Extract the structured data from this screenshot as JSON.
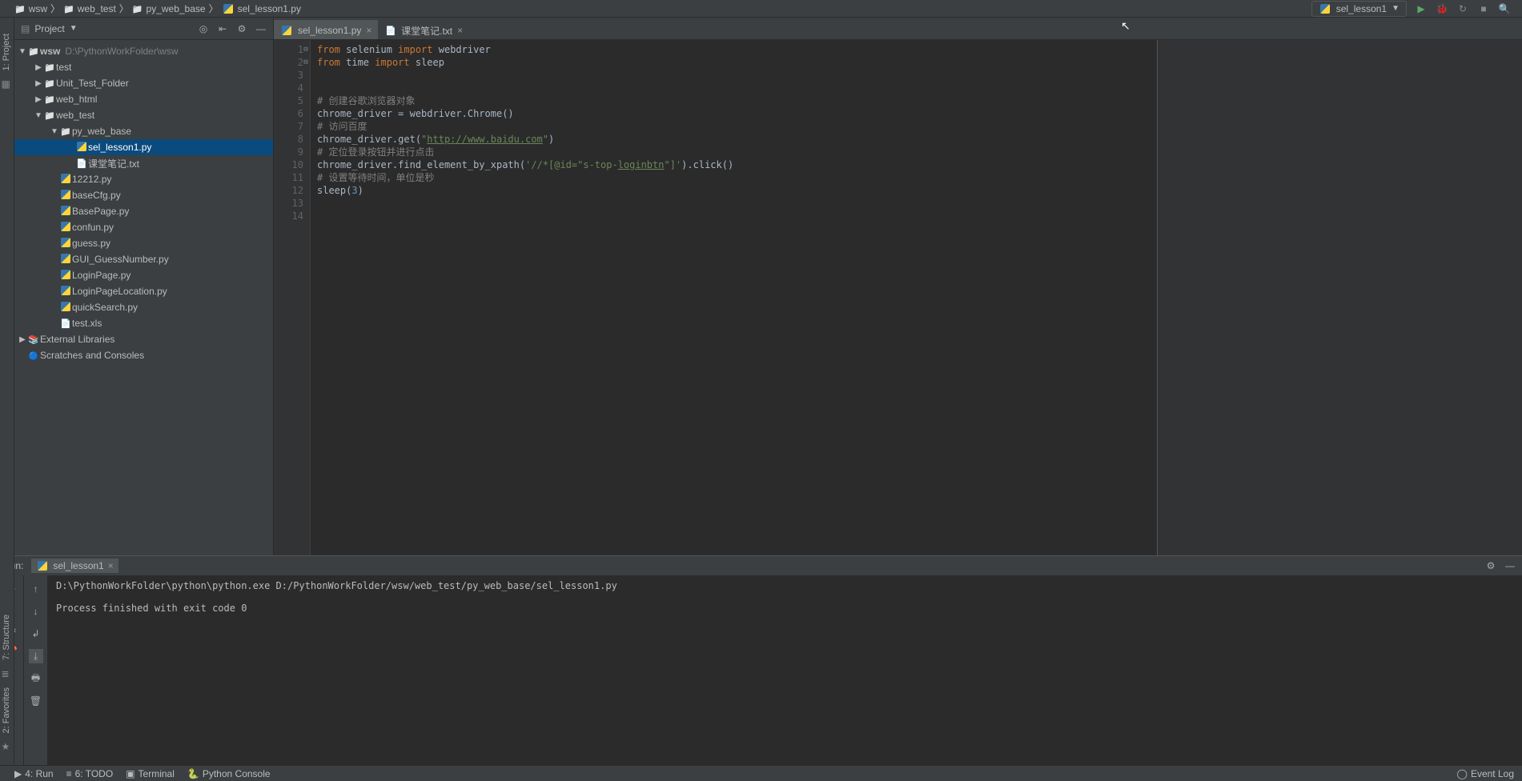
{
  "breadcrumb": {
    "root": "wsw",
    "p1": "web_test",
    "p2": "py_web_base",
    "file": "sel_lesson1.py"
  },
  "toolbar": {
    "run_config": "sel_lesson1"
  },
  "project": {
    "title": "Project",
    "root": "wsw",
    "root_path": "D:\\PythonWorkFolder\\wsw",
    "nodes": {
      "test": "test",
      "unit_test": "Unit_Test_Folder",
      "web_html": "web_html",
      "web_test": "web_test",
      "py_web_base": "py_web_base",
      "sel_lesson1": "sel_lesson1.py",
      "notes": "课堂笔记.txt",
      "f12212": "12212.py",
      "basecfg": "baseCfg.py",
      "basepage": "BasePage.py",
      "confun": "confun.py",
      "guess": "guess.py",
      "gui_guess": "GUI_GuessNumber.py",
      "loginpage": "LoginPage.py",
      "loginloc": "LoginPageLocation.py",
      "quicksearch": "quickSearch.py",
      "testxls": "test.xls",
      "extlib": "External Libraries",
      "scratch": "Scratches and Consoles"
    }
  },
  "tabs": {
    "t1": "sel_lesson1.py",
    "t2": "课堂笔记.txt"
  },
  "code": {
    "l1a": "from",
    "l1b": " selenium ",
    "l1c": "import",
    "l1d": " webdriver",
    "l2a": "from",
    "l2b": " time ",
    "l2c": "import",
    "l2d": " sleep",
    "l5": "# 创建谷歌浏览器对象",
    "l6a": "chrome_driver = webdriver.Chrome()",
    "l7": "# 访问百度",
    "l8a": "chrome_driver.get(",
    "l8b": "\"",
    "l8c": "http://www.baidu.com",
    "l8d": "\"",
    "l8e": ")",
    "l9": "# 定位登录按钮并进行点击",
    "l10a": "chrome_driver.find_element_by_xpath(",
    "l10b": "'//*[@id=\"s-top-",
    "l10c": "loginbtn",
    "l10d": "\"]'",
    "l10e": ").click()",
    "l11": "# 设置等待时间，单位是秒",
    "l12a": "sleep(",
    "l12b": "3",
    "l12c": ")"
  },
  "gutter": [
    "1",
    "2",
    "3",
    "4",
    "5",
    "6",
    "7",
    "8",
    "9",
    "10",
    "11",
    "12",
    "13",
    "14"
  ],
  "run": {
    "label": "Run:",
    "tab": "sel_lesson1",
    "line1": "D:\\PythonWorkFolder\\python\\python.exe D:/PythonWorkFolder/wsw/web_test/py_web_base/sel_lesson1.py",
    "line2": "",
    "line3": "Process finished with exit code 0"
  },
  "status": {
    "run": "4: Run",
    "todo": "6: TODO",
    "terminal": "Terminal",
    "pycon": "Python Console",
    "eventlog": "Event Log"
  },
  "sidetool": {
    "project": "1: Project",
    "structure": "7: Structure",
    "favorites": "2: Favorites"
  }
}
